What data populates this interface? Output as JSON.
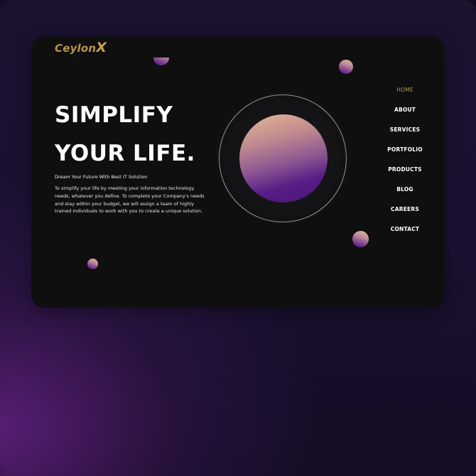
{
  "brand": {
    "logo_text": "Ceylon",
    "logo_x": "X",
    "accent_color": "#b5964a"
  },
  "hero": {
    "title_line1": "SIMPLIFY",
    "title_line2": "YOUR LIFE.",
    "subtitle": "Dream Your Future With Best IT Solution",
    "description": "To simplify your life by meeting your information technology needs, whatever you define. To complete your Company's needs and stay within your budget, we will assign a team of highly trained individuals to work with you to create a unique solution."
  },
  "nav": {
    "items": [
      {
        "label": "HOME",
        "active": true
      },
      {
        "label": "ABOUT",
        "active": false
      },
      {
        "label": "SERVICES",
        "active": false
      },
      {
        "label": "PORTFOLIO",
        "active": false
      },
      {
        "label": "PRODUCTS",
        "active": false
      },
      {
        "label": "BLOG",
        "active": false
      },
      {
        "label": "CAREERS",
        "active": false
      },
      {
        "label": "CONTACT",
        "active": false
      }
    ]
  },
  "decor": {
    "orb_gradient": [
      "#e6b898",
      "#8d5793",
      "#4a1478"
    ],
    "background_colors": [
      "#4e1b66",
      "#1a1030",
      "#120c22"
    ]
  }
}
